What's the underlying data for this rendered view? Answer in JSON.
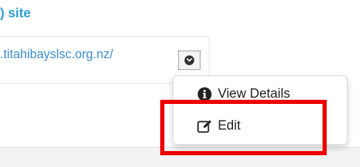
{
  "section": {
    "title": ") site"
  },
  "website": {
    "link_text": ".titahibayslsc.org.nz/"
  },
  "dropdown": {
    "toggle_icon": "chevron-down-icon",
    "items": [
      {
        "label": "View Details",
        "icon": "info-circle-icon"
      },
      {
        "label": "Edit",
        "icon": "edit-icon"
      }
    ]
  },
  "colors": {
    "link": "#3b8fd4",
    "title": "#2a9fd6",
    "highlight": "#ee0000"
  }
}
